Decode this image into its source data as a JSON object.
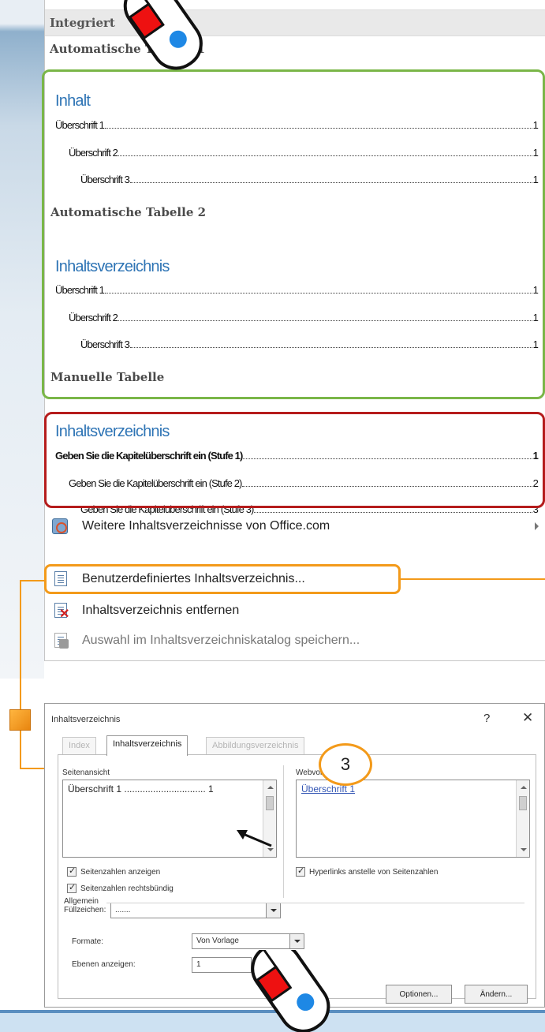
{
  "gallery": {
    "header_label": "Integriert",
    "auto_table_1_label": "Automatische Tabelle 1",
    "auto_table_2_label": "Automatische Tabelle 2",
    "manual_table_label": "Manuelle Tabelle",
    "toc1": {
      "title": "Inhalt",
      "lines": [
        {
          "label": "Überschrift 1",
          "page": "1"
        },
        {
          "label": "Überschrift 2",
          "page": "1"
        },
        {
          "label": "Überschrift 3",
          "page": "1"
        }
      ]
    },
    "toc2": {
      "title": "Inhaltsverzeichnis",
      "lines": [
        {
          "label": "Überschrift 1",
          "page": "1"
        },
        {
          "label": "Überschrift 2",
          "page": "1"
        },
        {
          "label": "Überschrift 3",
          "page": "1"
        }
      ]
    },
    "toc3": {
      "title": "Inhaltsverzeichnis",
      "lines": [
        {
          "label": "Geben Sie die Kapitelüberschrift ein (Stufe 1)",
          "page": "1"
        },
        {
          "label": "Geben Sie die Kapitelüberschrift ein (Stufe 2)",
          "page": "2"
        },
        {
          "label": "Geben Sie die Kapitelüberschrift ein (Stufe 3)",
          "page": "3"
        }
      ]
    }
  },
  "menu": {
    "more_from_office": "Weitere Inhaltsverzeichnisse von Office.com",
    "custom_toc": "Benutzerdefiniertes Inhaltsverzeichnis...",
    "remove_toc": "Inhaltsverzeichnis entfernen",
    "save_selection": "Auswahl im Inhaltsverzeichniskatalog speichern..."
  },
  "step_number": "3",
  "dialog": {
    "title": "Inhaltsverzeichnis",
    "help": "?",
    "close": "✕",
    "tabs": [
      "Index",
      "Inhaltsverzeichnis",
      "Abbildungsverzeichnis"
    ],
    "print_preview_label": "Seitenansicht",
    "print_preview_line": "Überschrift 1 ............................... 1",
    "web_preview_label": "Webvorschau",
    "web_preview_link": "Überschrift 1",
    "show_page_numbers": "Seitenzahlen anzeigen",
    "right_align_numbers": "Seitenzahlen rechtsbündig",
    "tab_leader_label": "Füllzeichen:",
    "tab_leader_value": ".......",
    "use_hyperlinks": "Hyperlinks anstelle von Seitenzahlen",
    "general_label": "Allgemein",
    "formats_label": "Formate:",
    "formats_value": "Von Vorlage",
    "show_levels_label": "Ebenen anzeigen:",
    "show_levels_value": "1",
    "options_button": "Optionen...",
    "modify_button": "Ändern..."
  }
}
